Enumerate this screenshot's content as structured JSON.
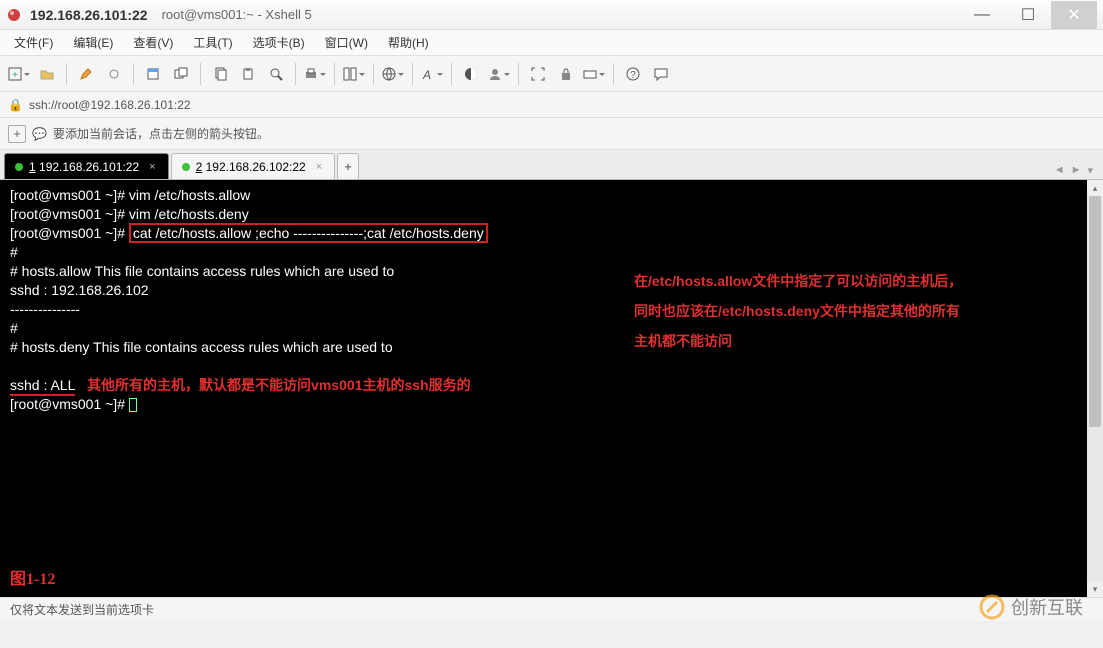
{
  "window": {
    "title_host": "192.168.26.101:22",
    "title_sub": "root@vms001:~ - Xshell 5",
    "min": "—",
    "max": "☐",
    "close": "✕"
  },
  "menu": {
    "file": "文件(F)",
    "edit": "编辑(E)",
    "view": "查看(V)",
    "tools": "工具(T)",
    "tabs": "选项卡(B)",
    "window": "窗口(W)",
    "help": "帮助(H)"
  },
  "address": {
    "lock": "🔒",
    "url": "ssh://root@192.168.26.101:22"
  },
  "sessionhint": {
    "plus": "+",
    "icon": "💬",
    "text": "要添加当前会话，点击左侧的箭头按钮。"
  },
  "tabs": {
    "t1_num": "1",
    "t1_label": "192.168.26.101:22",
    "t2_num": "2",
    "t2_label": "192.168.26.102:22",
    "add": "+",
    "left": "◄",
    "right": "►",
    "menu": "▾"
  },
  "term": {
    "p1": "[root@vms001 ~]# ",
    "c1": "vim /etc/hosts.allow",
    "p2": "[root@vms001 ~]# ",
    "c2": "vim /etc/hosts.deny",
    "p3": "[root@vms001 ~]# ",
    "c3": "cat /etc/hosts.allow ;echo ---------------;cat /etc/hosts.deny",
    "l4": "#",
    "l5": "# hosts.allow   This file contains access rules which are used to",
    "l6": "sshd : 192.168.26.102",
    "l7": "---------------",
    "l8": "#",
    "l9": "# hosts.deny    This file contains access rules which are used to",
    "l10": "sshd : ALL",
    "p4": "[root@vms001 ~]# ",
    "anno_right_1": "在/etc/hosts.allow文件中指定了可以访问的主机后，",
    "anno_right_2": "同时也应该在/etc/hosts.deny文件中指定其他的所有",
    "anno_right_3": "主机都不能访问",
    "anno_inline": "其他所有的主机，默认都是不能访问vms001主机的ssh服务的",
    "fig": "图1-12"
  },
  "status": {
    "text": "仅将文本发送到当前选项卡"
  },
  "watermark": "创新互联"
}
